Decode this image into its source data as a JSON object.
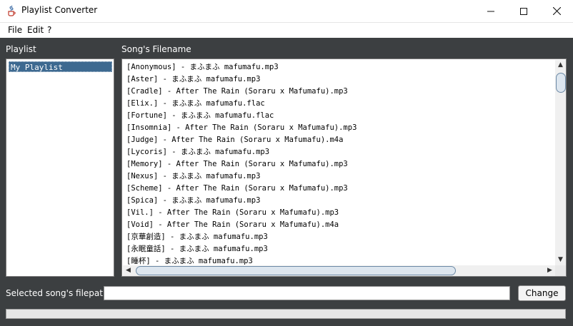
{
  "window": {
    "title": "Playlist Converter",
    "icon": "java-cup-icon",
    "controls": [
      "minimize",
      "maximize",
      "close"
    ]
  },
  "menu": [
    {
      "label": "File"
    },
    {
      "label": "Edit"
    },
    {
      "label": "?"
    }
  ],
  "playlist_panel": {
    "label": "Playlist",
    "items": [
      {
        "label": "My Playlist",
        "selected": true
      }
    ]
  },
  "songs_panel": {
    "label": "Song's Filename",
    "songs": [
      "[Anonymous] - まふまふ mafumafu.mp3",
      "[Aster] - まふまふ mafumafu.mp3",
      "[Cradle]  - After The Rain (Soraru x Mafumafu).mp3",
      "[Elix.] - まふまふ mafumafu.flac",
      "[Fortune] - まふまふ mafumafu.flac",
      "[Insomnia] - After The Rain (Soraru x Mafumafu).mp3",
      "[Judge] - After The Rain (Soraru x Mafumafu).m4a",
      "[Lycoris] - まふまふ mafumafu.mp3",
      "[Memory] - After The Rain (Soraru x Mafumafu).mp3",
      "[Nexus] - まふまふ mafumafu.mp3",
      "[Scheme]  - After The Rain (Soraru x Mafumafu).mp3",
      "[Spica] - まふまふ mafumafu.mp3",
      "[Vil.] - After The Rain (Soraru x Mafumafu).mp3",
      "[Void] - After The Rain (Soraru x Mafumafu).m4a",
      "[京華創造] - まふまふ mafumafu.mp3",
      "[永眠童話] - まふまふ mafumafu.mp3",
      "[睡杯] - まふまふ mafumafu.mp3"
    ]
  },
  "filepath": {
    "label": "Selected song's filepath:",
    "value": ""
  },
  "change_button": {
    "label": "Change"
  },
  "progress": {
    "value": 0
  },
  "colors": {
    "background": "#3c3f41",
    "selection": "#3d6990",
    "scroll_thumb_border": "#6d8aa6"
  }
}
